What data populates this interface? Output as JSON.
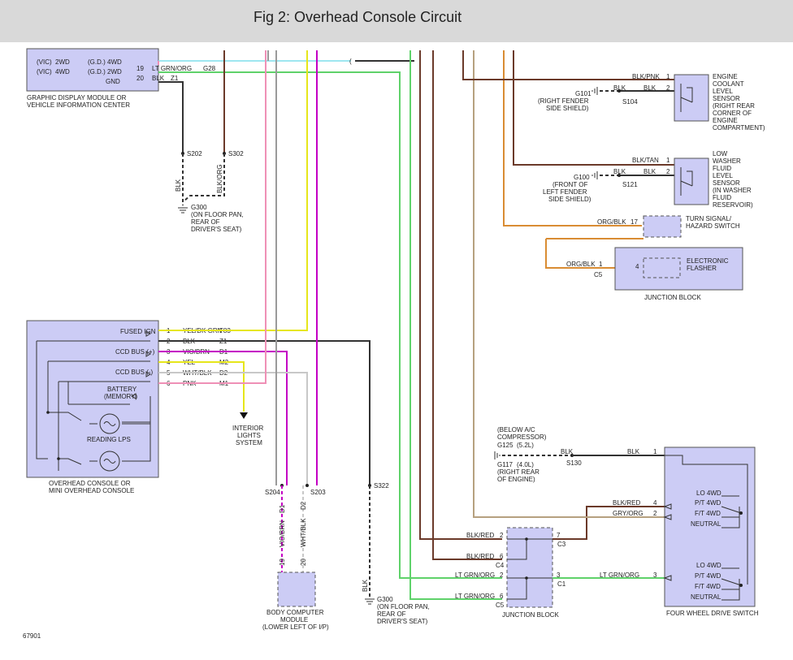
{
  "title": "Fig 2: Overhead Console Circuit",
  "figure_id": "67901",
  "gdm": {
    "rows": [
      {
        "l": "(VIC)",
        "m": "2WD",
        "r": "(G.D.)",
        "s": "4WD"
      },
      {
        "l": "(VIC)",
        "m": "4WD",
        "r": "(G.D.)",
        "s": "2WD"
      }
    ],
    "gnd": "GND",
    "name_l1": "GRAPHIC DISPLAY MODULE OR",
    "name_l2": "VEHICLE INFORMATION CENTER",
    "pin19": "19",
    "w19": "LT GRN/ORG",
    "c19": "G28",
    "pin20": "20",
    "w20": "BLK",
    "c20": "Z1"
  },
  "splices": {
    "s202": "S202",
    "s302": "S302",
    "s204": "S204",
    "s203": "S203",
    "s322": "S322",
    "s104": "S104",
    "s121": "S121",
    "s130": "S130"
  },
  "g300a": {
    "wire1": "BLK",
    "wire2": "BLK/ORG",
    "name": "G300",
    "l1": "(ON FLOOR PAN,",
    "l2": "REAR OF",
    "l3": "DRIVER'S SEAT)"
  },
  "g300b": {
    "wire": "BLK",
    "name": "G300",
    "l1": "(ON FLOOR PAN,",
    "l2": "REAR OF",
    "l3": "DRIVER'S SEAT)"
  },
  "ecl": {
    "w1": "BLK/PNK",
    "p1": "1",
    "w2": "BLK",
    "p2": "2",
    "g_wire": "BLK",
    "ground": "G101",
    "gl1": "(RIGHT FENDER",
    "gl2": "SIDE SHIELD)",
    "n1": "ENGINE",
    "n2": "COOLANT",
    "n3": "LEVEL",
    "n4": "SENSOR",
    "n5": "(RIGHT REAR",
    "n6": "CORNER OF",
    "n7": "ENGINE",
    "n8": "COMPARTMENT)"
  },
  "lwf": {
    "w1": "BLK/TAN",
    "p1": "1",
    "w2": "BLK",
    "p2": "2",
    "g_wire": "BLK",
    "ground": "G100",
    "gl1": "(FRONT OF",
    "gl2": "LEFT FENDER",
    "gl3": "SIDE SHIELD)",
    "n1": "LOW",
    "n2": "WASHER",
    "n3": "FLUID",
    "n4": "LEVEL",
    "n5": "SENSOR",
    "n6": "(IN WASHER",
    "n7": "FLUID",
    "n8": "RESERVOIR)"
  },
  "turn": {
    "wire": "ORG/BLK",
    "pin": "17",
    "n1": "TURN SIGNAL/",
    "n2": "HAZARD SWITCH"
  },
  "flasher": {
    "wire": "ORG/BLK",
    "pin": "1",
    "conn": "C5",
    "inner_pin": "4",
    "n1": "ELECTRONIC",
    "n2": "FLASHER",
    "jb": "JUNCTION BLOCK"
  },
  "console": {
    "labels": [
      "FUSED IGN",
      "CCD BUS (+)",
      "CCD BUS (-)"
    ],
    "battery1": "BATTERY",
    "battery2": "(MEMORY)",
    "reading": "READING LPS",
    "name_l1": "OVERHEAD CONSOLE OR",
    "name_l2": "MINI OVERHEAD CONSOLE",
    "pins": [
      {
        "n": "1",
        "w": "YEL/DK GRN",
        "c": "F83"
      },
      {
        "n": "2",
        "w": "BLK",
        "c": "Z1"
      },
      {
        "n": "3",
        "w": "VIO/BRN",
        "c": "D1"
      },
      {
        "n": "4",
        "w": "YEL",
        "c": "M2"
      },
      {
        "n": "5",
        "w": "WHT/BLK",
        "c": "D2"
      },
      {
        "n": "6",
        "w": "PNK",
        "c": "M1"
      }
    ]
  },
  "interior": {
    "l1": "INTERIOR",
    "l2": "LIGHTS",
    "l3": "SYSTEM"
  },
  "bcm": {
    "w1": "VIO/BRN",
    "c1": "D1",
    "p1": "19",
    "w2": "WHT/BLK",
    "c2": "D2",
    "p2": "20",
    "n1": "BODY COMPUTER",
    "n2": "MODULE",
    "n3": "(LOWER LEFT OF I/P)"
  },
  "g125": {
    "l1": "(BELOW A/C",
    "l2": "COMPRESSOR)",
    "l3": "G125",
    "l4": "(5.2L)",
    "l5": "G117",
    "l6": "(4.0L)",
    "l7": "(RIGHT REAR",
    "l8": "OF ENGINE)",
    "wire1": "BLK",
    "wire2": "BLK",
    "pin": "1"
  },
  "jb2": {
    "rows": [
      {
        "w": "BLK/RED",
        "p": "2",
        "conn": ""
      },
      {
        "w": "BLK/RED",
        "p": "6",
        "conn": "C4"
      },
      {
        "w": "LT GRN/ORG",
        "p": "2",
        "conn": ""
      },
      {
        "w": "LT GRN/ORG",
        "p": "6",
        "conn": "C5"
      }
    ],
    "r1": {
      "p": "7",
      "conn": "C3"
    },
    "r2": {
      "p": "3",
      "conn": "C1"
    },
    "name": "JUNCTION BLOCK"
  },
  "fwd": {
    "in": [
      {
        "w": "BLK/RED",
        "p": "4"
      },
      {
        "w": "GRY/ORG",
        "p": "2"
      },
      {
        "w": "LT GRN/ORG",
        "p": "3"
      }
    ],
    "top": [
      "LO 4WD",
      "P/T 4WD",
      "F/T 4WD",
      "NEUTRAL"
    ],
    "bot": [
      "LO 4WD",
      "P/T 4WD",
      "F/T 4WD",
      "NEUTRAL"
    ],
    "name": "FOUR WHEEL DRIVE SWITCH"
  }
}
